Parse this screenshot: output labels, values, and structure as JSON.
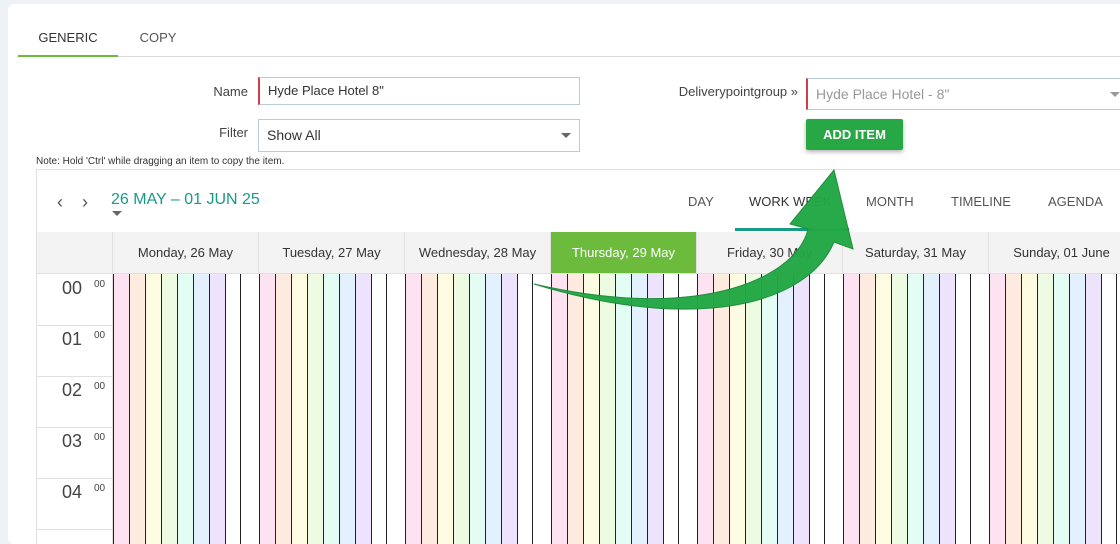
{
  "tabs": [
    {
      "label": "GENERIC",
      "active": true
    },
    {
      "label": "COPY",
      "active": false
    }
  ],
  "form": {
    "name_label": "Name",
    "name_value": "Hyde Place Hotel 8\"",
    "filter_label": "Filter",
    "filter_value": "Show All",
    "dpg_label": "Deliverypointgroup »",
    "dpg_value": "Hyde Place Hotel - 8\"",
    "add_item_label": "ADD ITEM"
  },
  "note": "Note: Hold 'Ctrl' while dragging an item to copy the item.",
  "scheduler": {
    "date_range": "26 MAY – 01 JUN 25",
    "views": [
      "DAY",
      "WORK WEEK",
      "MONTH",
      "TIMELINE",
      "AGENDA"
    ],
    "active_view": "WORK WEEK",
    "days": [
      "Monday, 26 May",
      "Tuesday, 27 May",
      "Wednesday, 28 May",
      "Thursday, 29 May",
      "Friday, 30 May",
      "Saturday, 31 May",
      "Sunday, 01 June"
    ],
    "today_index": 3,
    "hours": [
      {
        "h": "00",
        "m": "00"
      },
      {
        "h": "01",
        "m": "00"
      },
      {
        "h": "02",
        "m": "00"
      },
      {
        "h": "03",
        "m": "00"
      },
      {
        "h": "04",
        "m": "00"
      }
    ],
    "stripe_colors": [
      "#fde3f2",
      "#fdebe0",
      "#fefbe3",
      "#eefbe3",
      "#e3fdf5",
      "#e3f0fd",
      "#eee3fd",
      "#ffffff"
    ]
  },
  "colors": {
    "accent_green": "#6cbb3c",
    "button_green": "#28a745",
    "teal": "#199a87",
    "arrow_green": "#22a845"
  }
}
